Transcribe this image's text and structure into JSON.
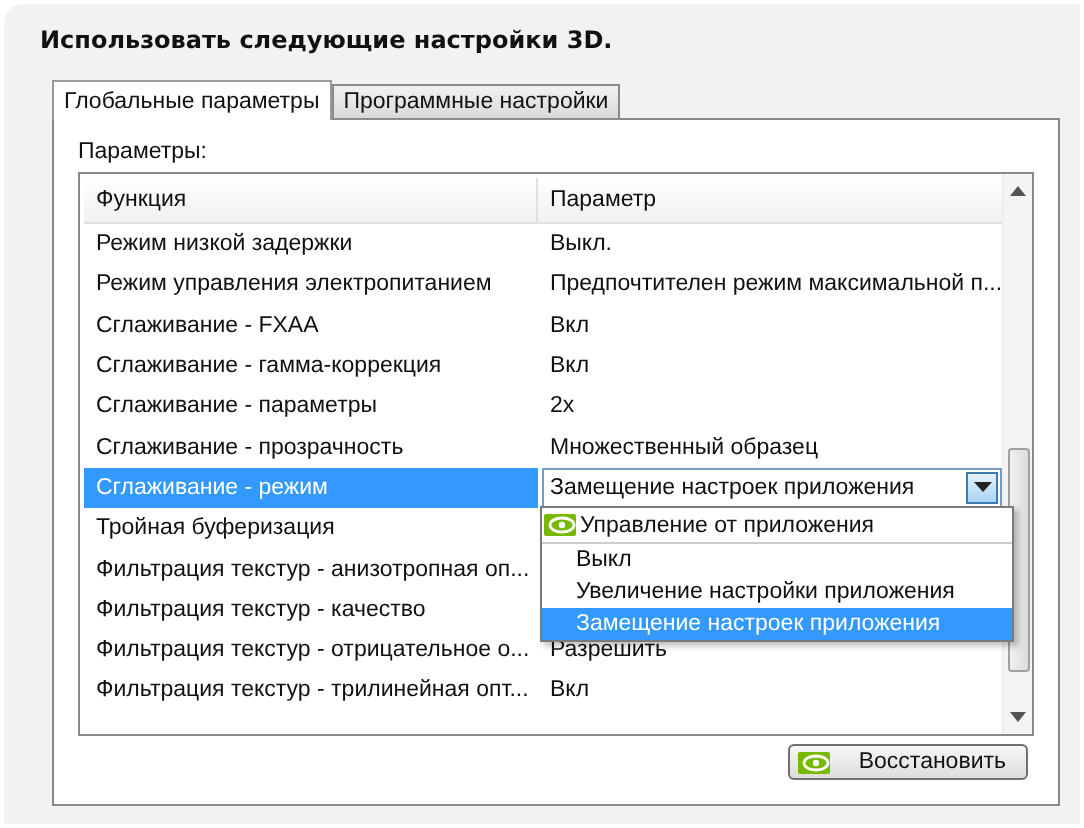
{
  "title": "Использовать следующие настройки 3D.",
  "tabs": [
    {
      "label": "Глобальные параметры",
      "selected": true
    },
    {
      "label": "Программные настройки",
      "selected": false
    }
  ],
  "section_label": "Параметры:",
  "table": {
    "columns": [
      "Функция",
      "Параметр"
    ],
    "rows": [
      {
        "function": "Режим низкой задержки",
        "value": "Выкл.",
        "selected": false
      },
      {
        "function": "Режим управления электропитанием",
        "value": "Предпочтителен режим максимальной п...",
        "selected": false
      },
      {
        "function": "Сглаживание - FXAA",
        "value": "Вкл",
        "selected": false
      },
      {
        "function": "Сглаживание - гамма-коррекция",
        "value": "Вкл",
        "selected": false
      },
      {
        "function": "Сглаживание - параметры",
        "value": "2x",
        "selected": false
      },
      {
        "function": "Сглаживание - прозрачность",
        "value": "Множественный образец",
        "selected": false
      },
      {
        "function": "Сглаживание - режим",
        "value": "Замещение настроек приложения",
        "selected": true
      },
      {
        "function": "Тройная буферизация",
        "selected": false
      },
      {
        "function": "Фильтрация текстур - анизотропная оп...",
        "selected": false
      },
      {
        "function": "Фильтрация текстур - качество",
        "selected": false
      },
      {
        "function": "Фильтрация текстур - отрицательное о...",
        "value": "Разрешить",
        "selected": false
      },
      {
        "function": "Фильтрация текстур - трилинейная опт...",
        "value": "Вкл",
        "selected": false
      }
    ]
  },
  "dropdown": {
    "items": [
      {
        "label": "Управление от приложения",
        "kind": "default",
        "selected": false
      },
      {
        "label": "Выкл",
        "kind": "option",
        "selected": false
      },
      {
        "label": "Увеличение настройки приложения",
        "kind": "option",
        "selected": false
      },
      {
        "label": "Замещение настроек приложения",
        "kind": "option",
        "selected": true
      }
    ]
  },
  "restore_button": "Восстановить"
}
